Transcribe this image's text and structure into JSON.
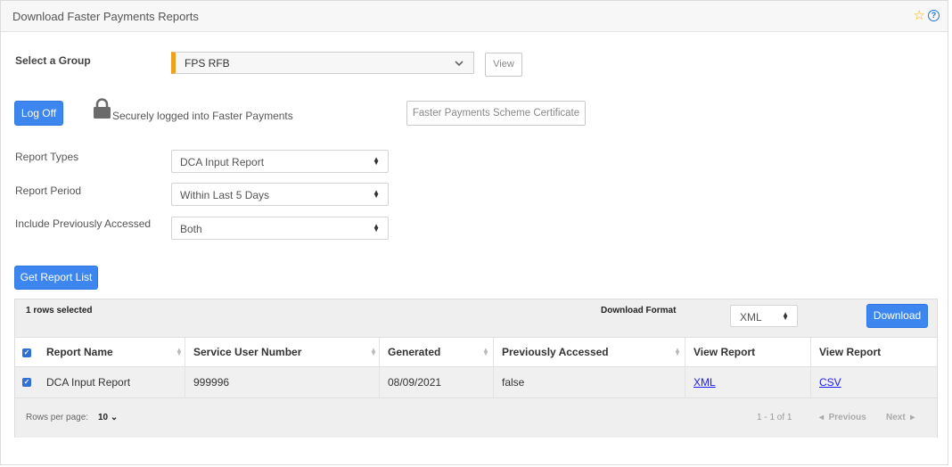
{
  "panel": {
    "title": "Download Faster Payments Reports"
  },
  "group": {
    "label": "Select a Group",
    "selected": "FPS RFB",
    "view_button": "View"
  },
  "session": {
    "logoff_button": "Log Off",
    "status_text": "Securely logged into Faster Payments",
    "certificate_button": "Faster Payments Scheme Certificate"
  },
  "filters": {
    "report_types": {
      "label": "Report Types",
      "value": "DCA Input Report"
    },
    "report_period": {
      "label": "Report Period",
      "value": "Within Last 5 Days"
    },
    "include_accessed": {
      "label": "Include Previously Accessed",
      "value": "Both"
    }
  },
  "get_list_button": "Get Report List",
  "table": {
    "selected_text": "1 rows selected",
    "format_label": "Download Format",
    "format_value": "XML",
    "download_button": "Download",
    "columns": [
      "Report Name",
      "Service User Number",
      "Generated",
      "Previously Accessed",
      "View Report",
      "View Report"
    ],
    "rows": [
      [
        "DCA Input Report",
        "999996",
        "08/09/2021",
        "false",
        "XML",
        "CSV"
      ]
    ],
    "footer": {
      "rows_per_page_label": "Rows per page:",
      "rows_per_page_value": "10",
      "page_info": "1 - 1 of 1",
      "prev": "Previous",
      "next": "Next"
    }
  },
  "colors": {
    "accent": "#3d86f0",
    "group_marker": "#f0a020",
    "star": "#f0b400",
    "help": "#1e73d8"
  },
  "icons": [
    "star-icon",
    "help-icon",
    "chevron-down-icon",
    "lock-icon",
    "sort-icon",
    "checkbox-icon"
  ]
}
